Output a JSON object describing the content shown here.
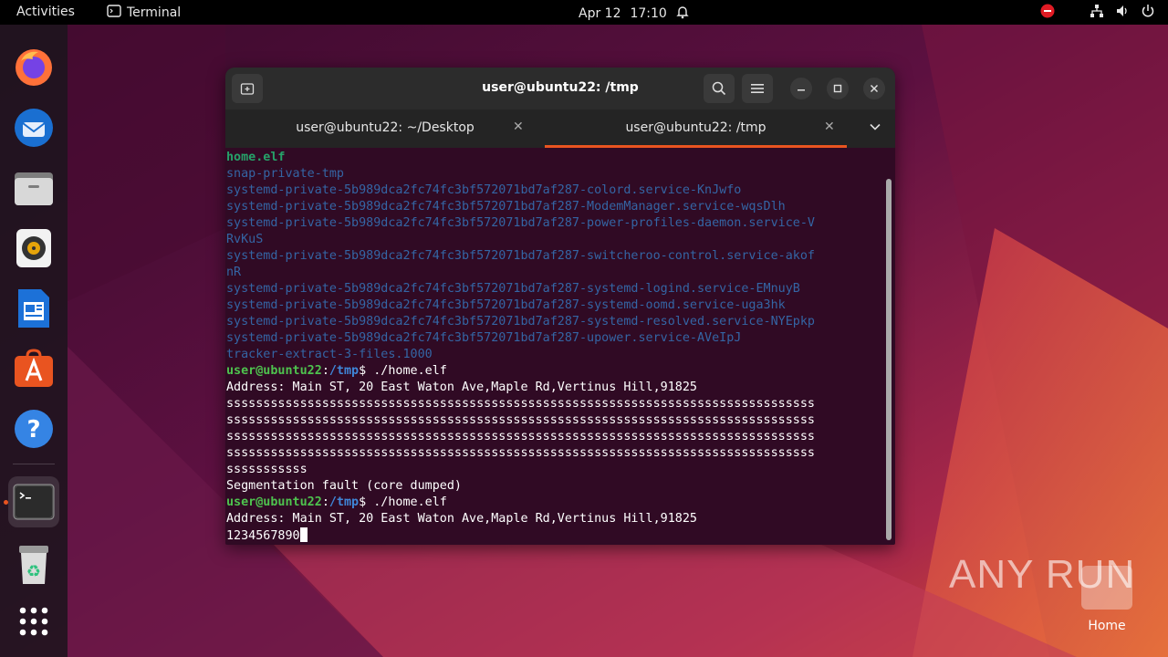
{
  "topbar": {
    "activities": "Activities",
    "app_name": "Terminal",
    "date": "Apr 12",
    "time": "17:10"
  },
  "dock": {
    "apps": [
      "firefox-icon",
      "thunderbird-icon",
      "files-icon",
      "rhythmbox-icon",
      "writer-icon",
      "app-center-icon",
      "help-icon",
      "terminal-icon",
      "trash-icon",
      "show-apps-icon"
    ]
  },
  "window": {
    "title": "user@ubuntu22: /tmp",
    "tabs": [
      {
        "label": "user@ubuntu22: ~/Desktop",
        "active": false
      },
      {
        "label": "user@ubuntu22: /tmp",
        "active": true
      }
    ]
  },
  "terminal": {
    "lines": [
      {
        "kind": "exec",
        "text": "home.elf"
      },
      {
        "kind": "dir",
        "text": "snap-private-tmp"
      },
      {
        "kind": "dir",
        "text": "systemd-private-5b989dca2fc74fc3bf572071bd7af287-colord.service-KnJwfo"
      },
      {
        "kind": "dir",
        "text": "systemd-private-5b989dca2fc74fc3bf572071bd7af287-ModemManager.service-wqsDlh"
      },
      {
        "kind": "dir",
        "text": "systemd-private-5b989dca2fc74fc3bf572071bd7af287-power-profiles-daemon.service-V"
      },
      {
        "kind": "dir",
        "text": "RvKuS"
      },
      {
        "kind": "dir",
        "text": "systemd-private-5b989dca2fc74fc3bf572071bd7af287-switcheroo-control.service-akof"
      },
      {
        "kind": "dir",
        "text": "nR"
      },
      {
        "kind": "dir",
        "text": "systemd-private-5b989dca2fc74fc3bf572071bd7af287-systemd-logind.service-EMnuyB"
      },
      {
        "kind": "dir",
        "text": "systemd-private-5b989dca2fc74fc3bf572071bd7af287-systemd-oomd.service-uga3hk"
      },
      {
        "kind": "dir",
        "text": "systemd-private-5b989dca2fc74fc3bf572071bd7af287-systemd-resolved.service-NYEpkp"
      },
      {
        "kind": "dir",
        "text": "systemd-private-5b989dca2fc74fc3bf572071bd7af287-upower.service-AVeIpJ"
      },
      {
        "kind": "dir",
        "text": "tracker-extract-3-files.1000"
      },
      {
        "kind": "prompt",
        "user": "user@ubuntu22",
        "sep": ":",
        "path": "/tmp",
        "cmd": "$ ./home.elf"
      },
      {
        "kind": "out",
        "text": "Address: Main ST, 20 East Waton Ave,Maple Rd,Vertinus Hill,91825"
      },
      {
        "kind": "out",
        "text": "ssssssssssssssssssssssssssssssssssssssssssssssssssssssssssssssssssssssssssssssss"
      },
      {
        "kind": "out",
        "text": "ssssssssssssssssssssssssssssssssssssssssssssssssssssssssssssssssssssssssssssssss"
      },
      {
        "kind": "out",
        "text": "ssssssssssssssssssssssssssssssssssssssssssssssssssssssssssssssssssssssssssssssss"
      },
      {
        "kind": "out",
        "text": "ssssssssssssssssssssssssssssssssssssssssssssssssssssssssssssssssssssssssssssssss"
      },
      {
        "kind": "out",
        "text": "sssssssssss"
      },
      {
        "kind": "out",
        "text": "Segmentation fault (core dumped)"
      },
      {
        "kind": "prompt",
        "user": "user@ubuntu22",
        "sep": ":",
        "path": "/tmp",
        "cmd": "$ ./home.elf"
      },
      {
        "kind": "out",
        "text": "Address: Main ST, 20 East Waton Ave,Maple Rd,Vertinus Hill,91825"
      },
      {
        "kind": "input",
        "text": "1234567890"
      }
    ]
  },
  "desktop": {
    "watermark": "ANY RUN",
    "home_label": "Home"
  },
  "colors": {
    "accent": "#e95420",
    "terminal_bg": "#300a24",
    "dir_blue": "#3465a4",
    "exec_green": "#26a269"
  }
}
